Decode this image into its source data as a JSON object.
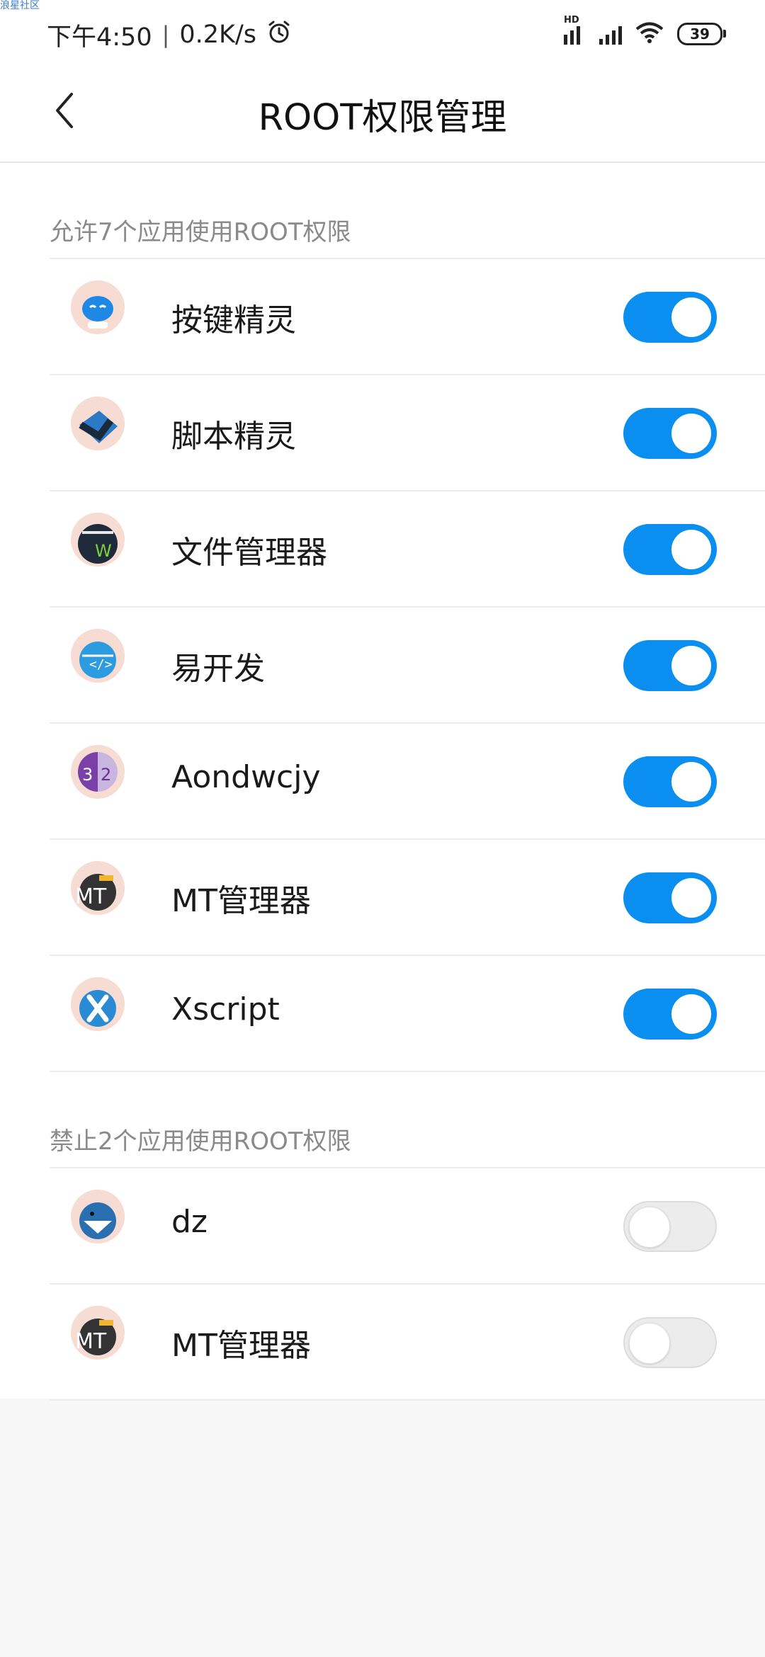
{
  "watermark": "浪星社区",
  "status_bar": {
    "time": "下午4:50",
    "separator": "|",
    "net_speed": "0.2K/s",
    "hd_label": "HD",
    "battery": "39",
    "icons": [
      "alarm-icon",
      "signal-hd-icon",
      "signal-icon",
      "wifi-icon",
      "battery-icon"
    ]
  },
  "header": {
    "title": "ROOT权限管理",
    "back_icon": "chevron-left-icon"
  },
  "allowed": {
    "title": "允许7个应用使用ROOT权限",
    "apps": [
      {
        "name": "按键精灵",
        "enabled": true,
        "icon": "robot-icon",
        "color": "#1e88e5"
      },
      {
        "name": "脚本精灵",
        "enabled": true,
        "icon": "script-icon",
        "color": "#2b79c7"
      },
      {
        "name": "文件管理器",
        "enabled": true,
        "icon": "file-manager-icon",
        "color": "#1f2a3a"
      },
      {
        "name": "易开发",
        "enabled": true,
        "icon": "code-icon",
        "color": "#2d9be0"
      },
      {
        "name": "Aondwcjy",
        "enabled": true,
        "icon": "number-32-icon",
        "color": "#7b3fa8"
      },
      {
        "name": "MT管理器",
        "enabled": true,
        "icon": "mt-icon",
        "color": "#333333"
      },
      {
        "name": "Xscript",
        "enabled": true,
        "icon": "x-icon",
        "color": "#2a8ad4"
      }
    ]
  },
  "denied": {
    "title": "禁止2个应用使用ROOT权限",
    "apps": [
      {
        "name": "dz",
        "enabled": false,
        "icon": "shark-icon",
        "color": "#2a6fb0"
      },
      {
        "name": "MT管理器",
        "enabled": false,
        "icon": "mt-icon",
        "color": "#333333"
      }
    ]
  },
  "colors": {
    "toggle_on": "#0a8ff0",
    "toggle_off": "#ececec",
    "section_text": "#8a8a8a",
    "background": "#f7f7f7"
  }
}
